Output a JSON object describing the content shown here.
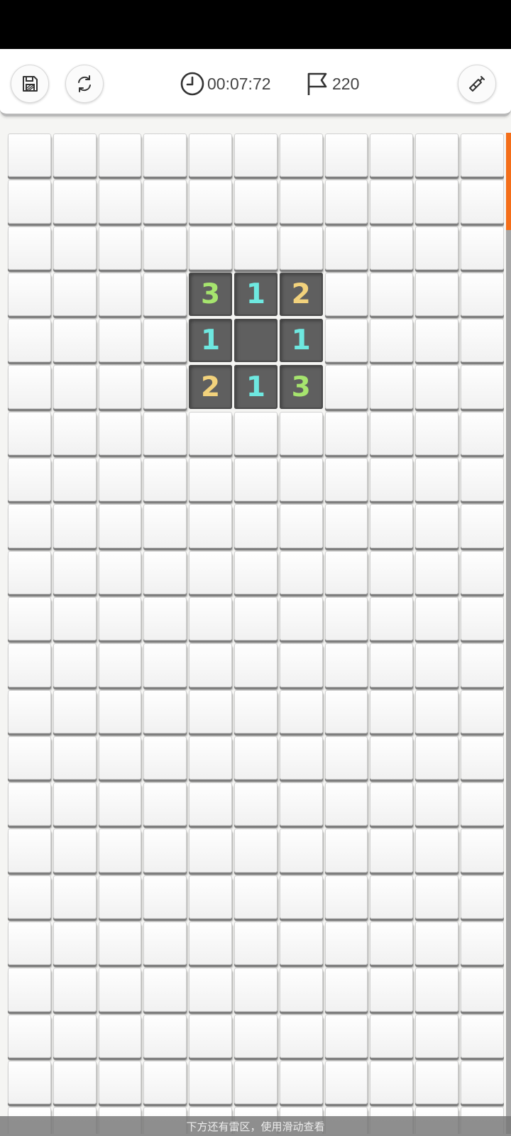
{
  "toolbar": {
    "save_icon": "save-icon",
    "restart_icon": "restart-icon",
    "timer_icon": "clock-icon",
    "timer_value": "00:07:72",
    "flag_icon": "flag-icon",
    "flags_remaining": "220",
    "dig_icon": "shovel-icon"
  },
  "board": {
    "columns": 11,
    "visible_rows": 22,
    "revealed": [
      {
        "row": 3,
        "col": 4,
        "value": "3"
      },
      {
        "row": 3,
        "col": 5,
        "value": "1"
      },
      {
        "row": 3,
        "col": 6,
        "value": "2"
      },
      {
        "row": 4,
        "col": 4,
        "value": "1"
      },
      {
        "row": 4,
        "col": 5,
        "value": ""
      },
      {
        "row": 4,
        "col": 6,
        "value": "1"
      },
      {
        "row": 5,
        "col": 4,
        "value": "2"
      },
      {
        "row": 5,
        "col": 5,
        "value": "1"
      },
      {
        "row": 5,
        "col": 6,
        "value": "3"
      }
    ],
    "number_colors": {
      "1": "#6ee8e0",
      "2": "#f2d27c",
      "3": "#a6e46e"
    }
  },
  "scrollbar": {
    "thumb_color": "#f46e19",
    "track_color": "#a7a7a7"
  },
  "hint": {
    "text": "下方还有雷区，使用滑动查看"
  }
}
